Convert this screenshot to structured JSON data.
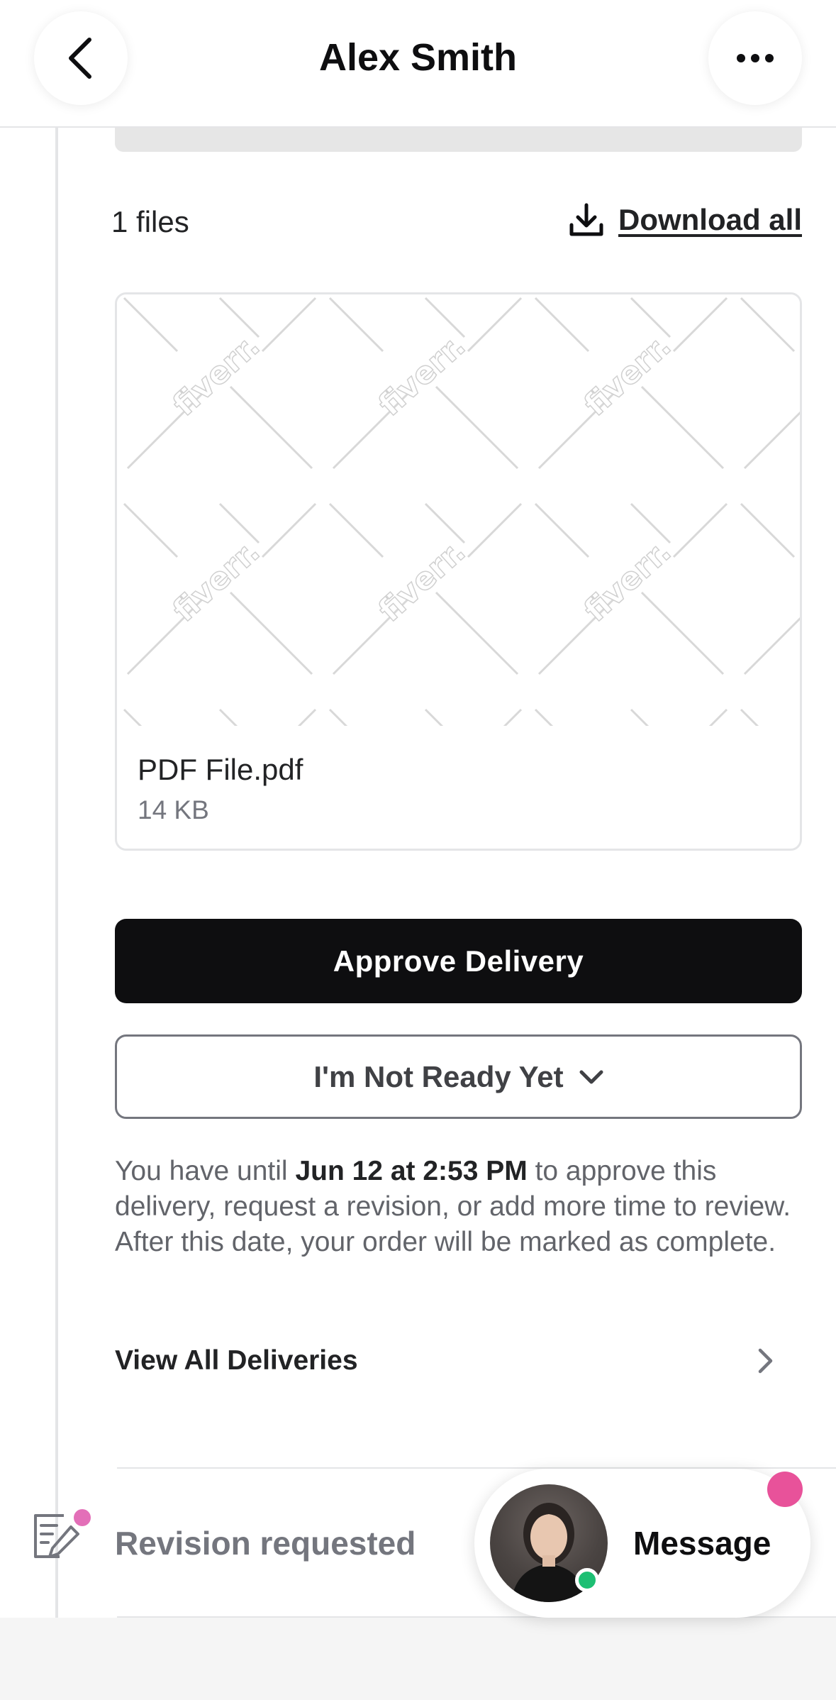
{
  "header": {
    "title": "Alex Smith",
    "back_icon": "chevron-left-icon",
    "more_icon": "more-horizontal-icon"
  },
  "files": {
    "count_label": "1 files",
    "download_all_label": "Download all",
    "download_icon": "download-icon"
  },
  "file_card": {
    "watermark": "fiverr.",
    "name": "PDF File.pdf",
    "size": "14 KB"
  },
  "actions": {
    "approve_label": "Approve Delivery",
    "not_ready_label": "I'm Not Ready Yet",
    "not_ready_icon": "chevron-down-icon"
  },
  "deadline": {
    "prefix": "You have until ",
    "date": "Jun 12 at 2:53 PM",
    "suffix": " to approve this delivery, request a revision, or add more time to review. After this date, your order will be marked as complete."
  },
  "view_all": {
    "label": "View All Deliveries",
    "icon": "chevron-right-icon"
  },
  "timeline": {
    "revision_label": "Revision requested",
    "revision_icon": "edit-document-icon"
  },
  "message": {
    "label": "Message",
    "online": true
  },
  "colors": {
    "primary": "#0e0e10",
    "online": "#1dbf73",
    "notification": "#e8529a",
    "muted_text": "#74767e",
    "border": "#e4e5e7"
  }
}
